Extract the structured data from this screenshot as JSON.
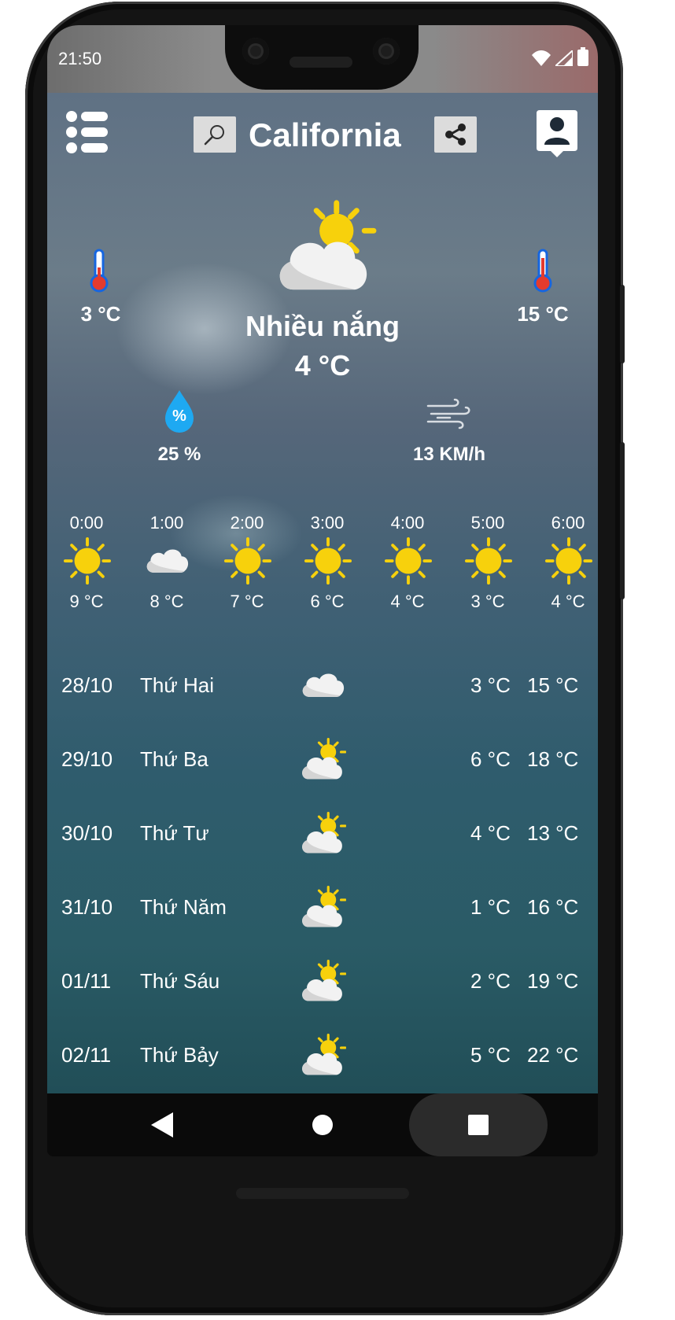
{
  "status_bar": {
    "time": "21:50"
  },
  "header": {
    "city": "California"
  },
  "current": {
    "condition": "Nhiều nắng",
    "temperature": "4 °C",
    "min_temp": "3 °C",
    "max_temp": "15 °C",
    "humidity": "25 %",
    "humidity_symbol": "%",
    "wind": "13 KM/h"
  },
  "hourly": [
    {
      "time": "0:00",
      "icon": "sun-icon",
      "temp": "9 °C"
    },
    {
      "time": "1:00",
      "icon": "cloud-icon",
      "temp": "8 °C"
    },
    {
      "time": "2:00",
      "icon": "sun-icon",
      "temp": "7 °C"
    },
    {
      "time": "3:00",
      "icon": "sun-icon",
      "temp": "6 °C"
    },
    {
      "time": "4:00",
      "icon": "sun-icon",
      "temp": "4 °C"
    },
    {
      "time": "5:00",
      "icon": "sun-icon",
      "temp": "3 °C"
    },
    {
      "time": "6:00",
      "icon": "sun-icon",
      "temp": "4 °C"
    }
  ],
  "daily": [
    {
      "date": "28/10",
      "day": "Thứ Hai",
      "icon": "cloud-icon",
      "min": "3 °C",
      "max": "15 °C"
    },
    {
      "date": "29/10",
      "day": "Thứ Ba",
      "icon": "partly-sunny-icon",
      "min": "6 °C",
      "max": "18 °C"
    },
    {
      "date": "30/10",
      "day": "Thứ Tư",
      "icon": "partly-sunny-icon",
      "min": "4 °C",
      "max": "13 °C"
    },
    {
      "date": "31/10",
      "day": "Thứ Năm",
      "icon": "partly-sunny-icon",
      "min": "1 °C",
      "max": "16 °C"
    },
    {
      "date": "01/11",
      "day": "Thứ Sáu",
      "icon": "partly-sunny-icon",
      "min": "2 °C",
      "max": "19 °C"
    },
    {
      "date": "02/11",
      "day": "Thứ Bảy",
      "icon": "partly-sunny-icon",
      "min": "5 °C",
      "max": "22 °C"
    }
  ],
  "colors": {
    "sun": "#f7d10c",
    "humidity": "#1ea9f2",
    "thermo_blue": "#1666e0",
    "thermo_red": "#e33b2e"
  }
}
